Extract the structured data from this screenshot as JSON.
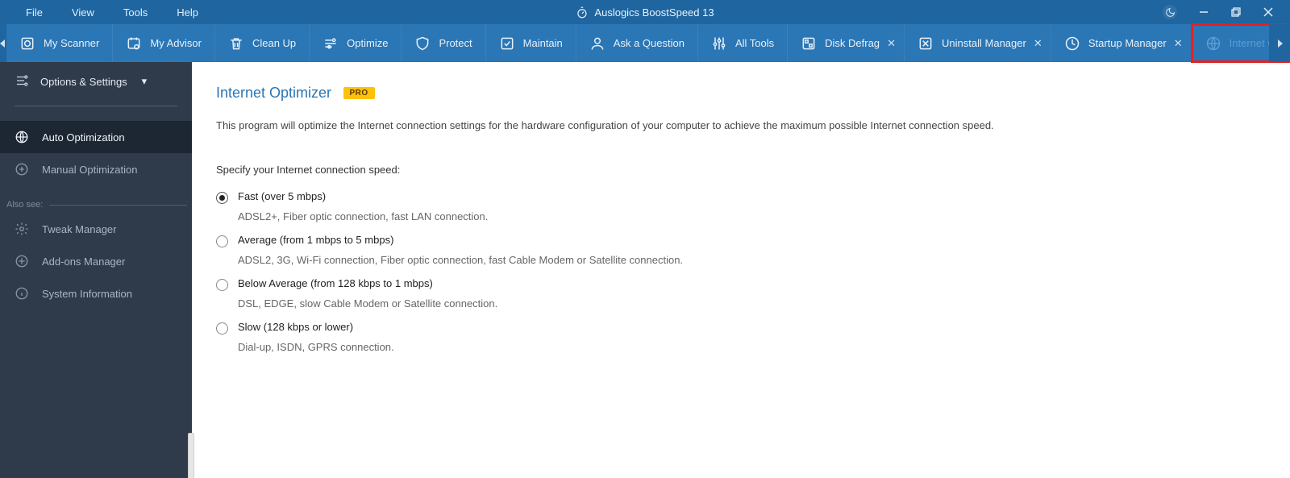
{
  "titlebar": {
    "menu": [
      "File",
      "View",
      "Tools",
      "Help"
    ],
    "app_title": "Auslogics BoostSpeed 13"
  },
  "toolbar": {
    "items": [
      {
        "label": "My Scanner",
        "icon": "scan"
      },
      {
        "label": "My Advisor",
        "icon": "advisor"
      },
      {
        "label": "Clean Up",
        "icon": "trash"
      },
      {
        "label": "Optimize",
        "icon": "optimize"
      },
      {
        "label": "Protect",
        "icon": "shield"
      },
      {
        "label": "Maintain",
        "icon": "maintain"
      },
      {
        "label": "Ask a Question",
        "icon": "person"
      },
      {
        "label": "All Tools",
        "icon": "tools"
      }
    ],
    "tabs": [
      {
        "label": "Disk Defrag",
        "icon": "defrag"
      },
      {
        "label": "Uninstall Manager",
        "icon": "uninstall"
      },
      {
        "label": "Startup Manager",
        "icon": "startup"
      },
      {
        "label": "Internet Optimizer",
        "icon": "globe",
        "highlighted": true
      }
    ]
  },
  "sidebar": {
    "options_label": "Options & Settings",
    "primary": [
      {
        "label": "Auto Optimization",
        "icon": "globe",
        "active": true
      },
      {
        "label": "Manual Optimization",
        "icon": "sliders",
        "active": false
      }
    ],
    "also_see_label": "Also see:",
    "secondary": [
      {
        "label": "Tweak Manager",
        "icon": "gear"
      },
      {
        "label": "Add-ons Manager",
        "icon": "addons"
      },
      {
        "label": "System Information",
        "icon": "info"
      }
    ]
  },
  "content": {
    "title": "Internet Optimizer",
    "badge": "PRO",
    "description": "This program will optimize the Internet connection settings for the hardware configuration of your computer to achieve the maximum possible Internet connection speed.",
    "specify_label": "Specify your Internet connection speed:",
    "options": [
      {
        "title": "Fast (over 5 mbps)",
        "sub": "ADSL2+, Fiber optic connection, fast LAN connection.",
        "selected": true
      },
      {
        "title": "Average (from 1 mbps to 5 mbps)",
        "sub": "ADSL2, 3G, Wi-Fi connection, Fiber optic connection, fast Cable Modem or Satellite connection.",
        "selected": false
      },
      {
        "title": "Below Average (from 128 kbps to 1 mbps)",
        "sub": "DSL, EDGE, slow Cable Modem or Satellite connection.",
        "selected": false
      },
      {
        "title": "Slow (128 kbps or lower)",
        "sub": "Dial-up, ISDN, GPRS connection.",
        "selected": false
      }
    ]
  }
}
